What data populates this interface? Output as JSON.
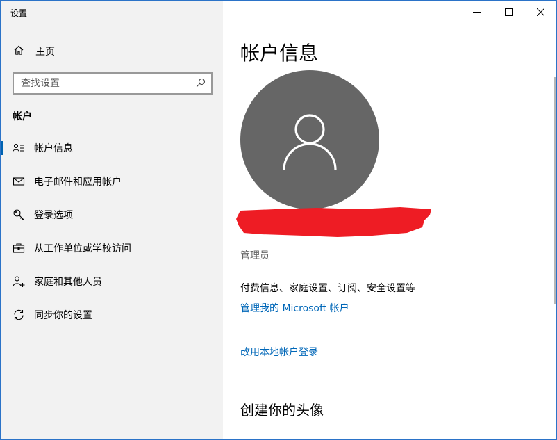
{
  "window": {
    "title": "设置"
  },
  "sidebar": {
    "home_label": "主页",
    "search_placeholder": "查找设置",
    "section_heading": "帐户",
    "items": [
      {
        "label": "帐户信息",
        "icon": "account-info-icon",
        "selected": true
      },
      {
        "label": "电子邮件和应用帐户",
        "icon": "mail-icon",
        "selected": false
      },
      {
        "label": "登录选项",
        "icon": "key-icon",
        "selected": false
      },
      {
        "label": "从工作单位或学校访问",
        "icon": "briefcase-icon",
        "selected": false
      },
      {
        "label": "家庭和其他人员",
        "icon": "person-add-icon",
        "selected": false
      },
      {
        "label": "同步你的设置",
        "icon": "sync-icon",
        "selected": false
      }
    ]
  },
  "main": {
    "title": "帐户信息",
    "role": "管理员",
    "info_text": "付费信息、家庭设置、订阅、安全设置等",
    "manage_link": "管理我的 Microsoft 帐户",
    "local_link": "改用本地帐户登录",
    "avatar_heading": "创建你的头像"
  },
  "colors": {
    "accent": "#0063b1",
    "link": "#0067b8",
    "avatar_bg": "#666666",
    "sidebar_bg": "#f2f2f2",
    "redaction": "#ee1c24"
  }
}
